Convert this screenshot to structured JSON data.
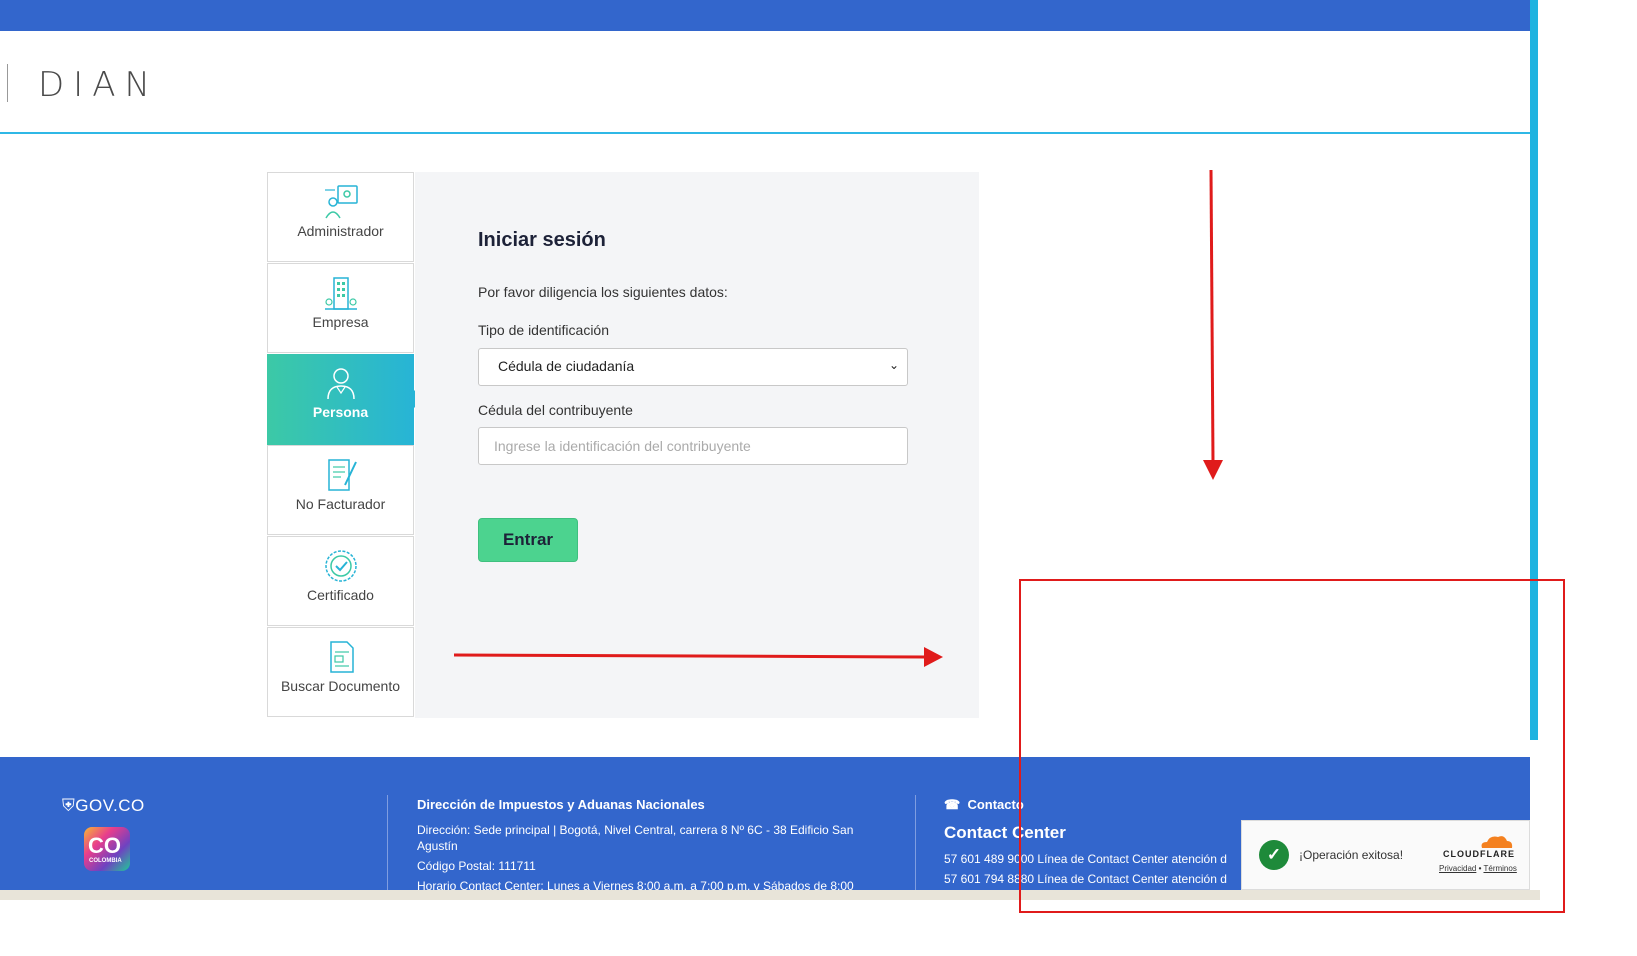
{
  "header": {
    "logo_text": "DIAN"
  },
  "tabs": [
    {
      "label": "Administrador",
      "icon": "admin-icon"
    },
    {
      "label": "Empresa",
      "icon": "building-icon"
    },
    {
      "label": "Persona",
      "icon": "person-icon",
      "active": true
    },
    {
      "label": "No Facturador",
      "icon": "document-edit-icon"
    },
    {
      "label": "Certificado",
      "icon": "certificate-icon"
    },
    {
      "label": "Buscar Documento",
      "icon": "search-document-icon"
    }
  ],
  "login": {
    "title": "Iniciar sesión",
    "intro": "Por favor diligencia los siguientes datos:",
    "id_type_label": "Tipo de identificación",
    "id_type_value": "Cédula de ciudadanía",
    "id_number_label": "Cédula del contribuyente",
    "id_number_placeholder": "Ingrese la identificación del contribuyente",
    "submit_label": "Entrar"
  },
  "footer": {
    "gov_label": "GOV.CO",
    "co_label": "CO",
    "co_sub": "COLOMBIA",
    "entity_title": "Dirección de Impuestos y Aduanas Nacionales",
    "address": "Dirección: Sede principal | Bogotá, Nivel Central, carrera 8 Nº 6C - 38 Edificio San Agustín",
    "postal_code": "Código Postal: 111711",
    "hours": "Horario Contact Center: Lunes a Viernes 8:00 a.m. a 7:00 p.m. y Sábados de 8:00",
    "contact_heading": "Contacto",
    "contact_center_title": "Contact Center",
    "phone_1": "57 601 489 9000 Línea de Contact Center atención d",
    "phone_2": "57 601 794 8880 Línea de Contact Center atención d"
  },
  "cloudflare": {
    "message": "¡Operación exitosa!",
    "brand": "CLOUDFLARE",
    "privacy": "Privacidad",
    "separator": "•",
    "terms": "Términos"
  },
  "colors": {
    "brand_blue": "#3366cc",
    "accent_cyan": "#1fb3e0",
    "button_green": "#4cd38f",
    "annotation_red": "#e01b1b"
  }
}
